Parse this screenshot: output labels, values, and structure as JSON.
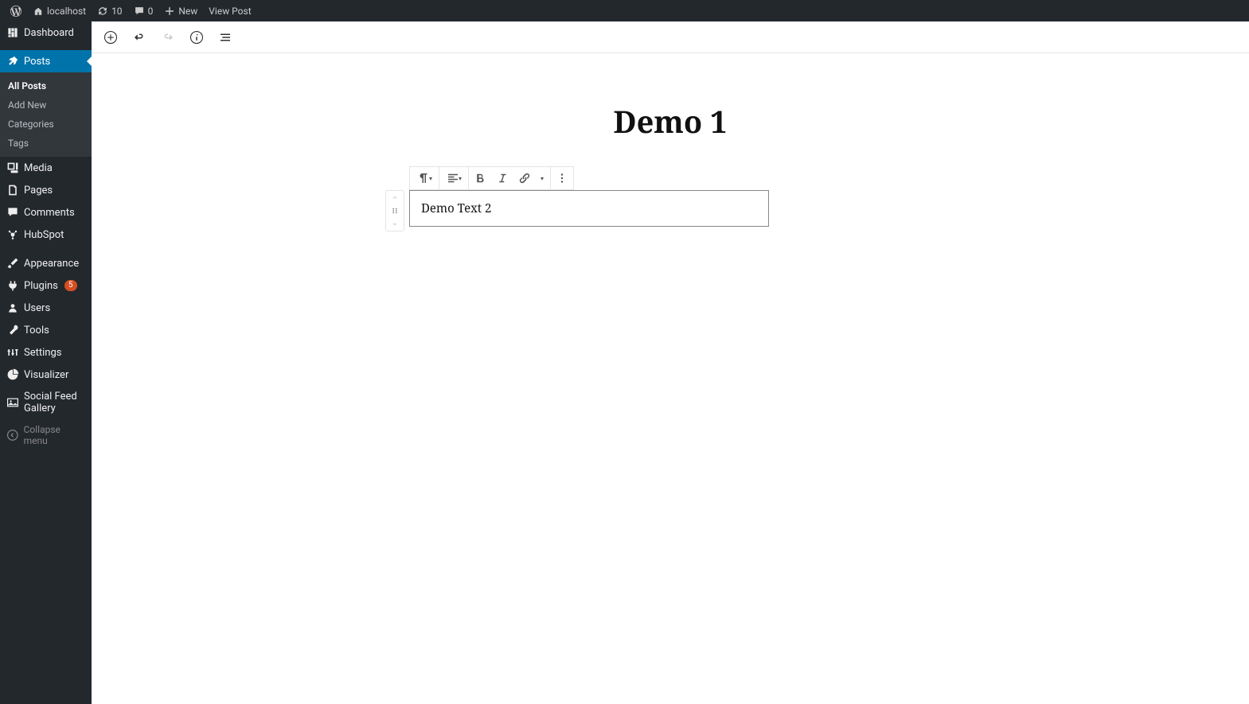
{
  "adminBar": {
    "siteName": "localhost",
    "updatesCount": "10",
    "commentsCount": "0",
    "newLabel": "New",
    "viewPostLabel": "View Post"
  },
  "sidebar": {
    "dashboard": "Dashboard",
    "posts": "Posts",
    "postsSubmenu": {
      "all": "All Posts",
      "addNew": "Add New",
      "categories": "Categories",
      "tags": "Tags"
    },
    "media": "Media",
    "pages": "Pages",
    "comments": "Comments",
    "hubspot": "HubSpot",
    "appearance": "Appearance",
    "plugins": "Plugins",
    "pluginsBadge": "5",
    "users": "Users",
    "tools": "Tools",
    "settings": "Settings",
    "visualizer": "Visualizer",
    "socialFeed": "Social Feed Gallery",
    "collapse": "Collapse menu"
  },
  "editor": {
    "postTitle": "Demo 1",
    "blockText": "Demo Text 2"
  }
}
